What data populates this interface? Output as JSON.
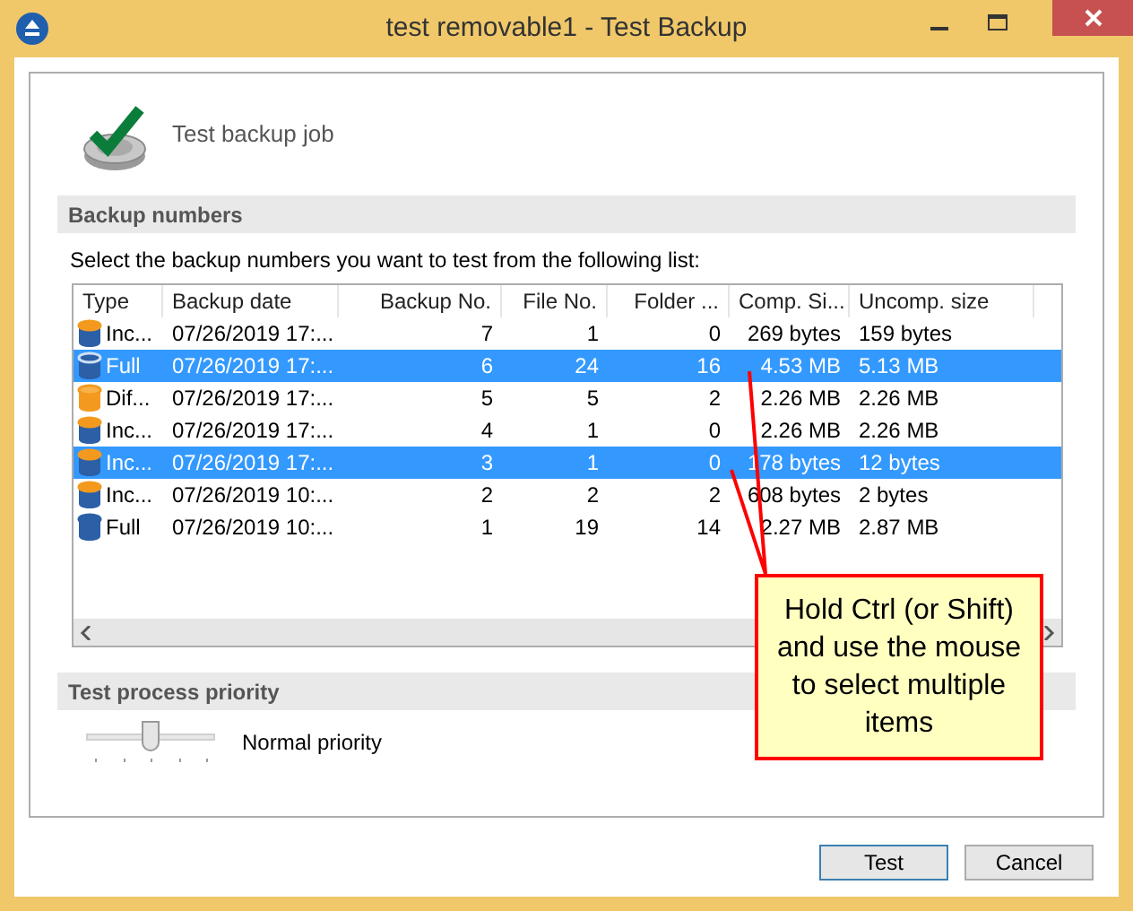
{
  "window": {
    "title": "test removable1 - Test Backup"
  },
  "header": {
    "title": "Test backup job"
  },
  "backup_numbers": {
    "heading": "Backup numbers",
    "instruction": "Select the backup numbers you want to test from the following list:",
    "columns": [
      "Type",
      "Backup date",
      "Backup No.",
      "File No.",
      "Folder ...",
      "Comp. Si...",
      "Uncomp. size"
    ],
    "rows": [
      {
        "kind": "incremental",
        "type": "Inc...",
        "date": "07/26/2019 17:...",
        "backup_no": "7",
        "file_no": "1",
        "folder": "0",
        "comp": "269 bytes",
        "uncomp": "159 bytes",
        "selected": false
      },
      {
        "kind": "full",
        "type": "Full",
        "date": "07/26/2019 17:...",
        "backup_no": "6",
        "file_no": "24",
        "folder": "16",
        "comp": "4.53 MB",
        "uncomp": "5.13 MB",
        "selected": true
      },
      {
        "kind": "differential",
        "type": "Dif...",
        "date": "07/26/2019 17:...",
        "backup_no": "5",
        "file_no": "5",
        "folder": "2",
        "comp": "2.26 MB",
        "uncomp": "2.26 MB",
        "selected": false
      },
      {
        "kind": "incremental",
        "type": "Inc...",
        "date": "07/26/2019 17:...",
        "backup_no": "4",
        "file_no": "1",
        "folder": "0",
        "comp": "2.26 MB",
        "uncomp": "2.26 MB",
        "selected": false
      },
      {
        "kind": "incremental",
        "type": "Inc...",
        "date": "07/26/2019 17:...",
        "backup_no": "3",
        "file_no": "1",
        "folder": "0",
        "comp": "178 bytes",
        "uncomp": "12 bytes",
        "selected": true
      },
      {
        "kind": "incremental",
        "type": "Inc...",
        "date": "07/26/2019 10:...",
        "backup_no": "2",
        "file_no": "2",
        "folder": "2",
        "comp": "608 bytes",
        "uncomp": "2 bytes",
        "selected": false
      },
      {
        "kind": "full",
        "type": "Full",
        "date": "07/26/2019 10:...",
        "backup_no": "1",
        "file_no": "19",
        "folder": "14",
        "comp": "2.27 MB",
        "uncomp": "2.87 MB",
        "selected": false
      }
    ]
  },
  "priority": {
    "heading": "Test process priority",
    "level": 0.5,
    "label": "Normal priority"
  },
  "callout": {
    "text": "Hold Ctrl (or Shift) and use the mouse to select multiple items"
  },
  "buttons": [
    "Test",
    "Cancel"
  ]
}
